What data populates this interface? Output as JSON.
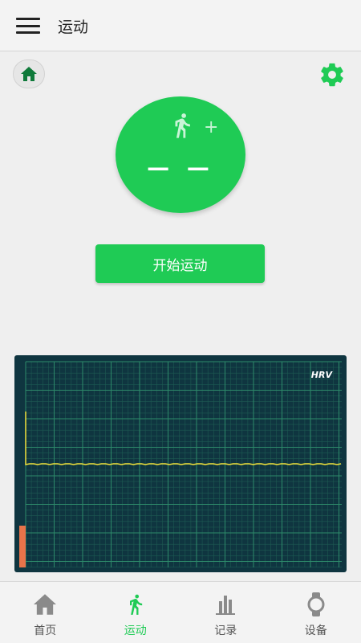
{
  "header": {
    "title": "运动"
  },
  "sport": {
    "value": "— —",
    "plus": "+",
    "start_label": "开始运动"
  },
  "chart_data": {
    "type": "line",
    "title": "HRV",
    "xlabel": "",
    "ylabel": "",
    "grid": true,
    "series": [
      {
        "values": [
          0,
          0,
          0,
          0,
          0,
          0,
          0,
          0,
          0,
          0,
          0,
          0,
          0,
          0,
          0,
          0,
          0,
          0,
          0,
          0,
          0,
          0,
          0,
          0,
          0,
          0,
          0,
          0,
          0,
          0,
          0,
          0,
          0,
          0,
          0,
          0,
          0,
          0,
          0,
          0,
          0,
          0,
          0,
          0,
          0,
          0,
          0,
          0,
          0,
          0,
          0,
          0,
          0,
          0,
          0,
          0,
          0,
          0,
          0,
          0,
          0,
          0,
          0,
          0,
          0,
          0,
          0,
          0,
          0,
          0,
          0,
          0,
          0,
          0,
          0,
          0,
          0,
          0,
          0,
          0
        ]
      }
    ]
  },
  "colors": {
    "accent": "#1fcb55",
    "chart_bg": "#0f3540",
    "grid_major": "#2d8a6a",
    "grid_minor": "#1d5a52",
    "line": "#f2e23a",
    "marker": "#e8734a"
  },
  "nav": {
    "items": [
      {
        "label": "首页",
        "icon": "home-icon"
      },
      {
        "label": "运动",
        "icon": "running-icon"
      },
      {
        "label": "记录",
        "icon": "bar-chart-icon"
      },
      {
        "label": "设备",
        "icon": "watch-icon"
      }
    ]
  }
}
